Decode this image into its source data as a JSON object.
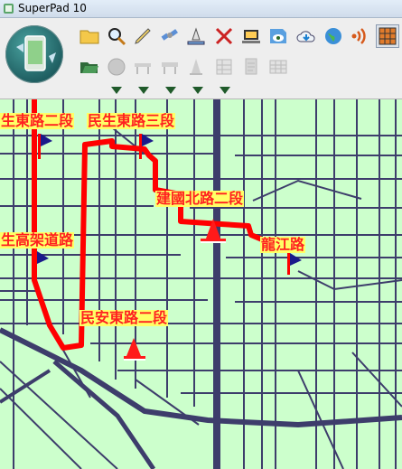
{
  "window": {
    "title": "SuperPad 10"
  },
  "toolbar": {
    "row1": [
      "open-folder-icon",
      "search-icon",
      "pen-icon",
      "satellite-icon",
      "ruler-icon",
      "close-tools-icon",
      "laptop-icon",
      "map-eye-icon",
      "cloud-download-icon",
      "globe-icon",
      "signal-icon",
      "grid-icon"
    ],
    "row2": [
      "folder-open-icon",
      "circle-icon",
      "barrier-icon",
      "barrier-alt-icon",
      "cone-icon",
      "table-icon",
      "document-icon",
      "spreadsheet-icon"
    ]
  },
  "map": {
    "route_color": "#ff0000",
    "road_color": "#3d3d6b",
    "background": "#ccffcc",
    "labels": {
      "l1": "生東路二段",
      "l2": "民生東路三段",
      "l3": "建國北路二段",
      "l4": "龍江路",
      "l5": "生高架道路",
      "l6": "民安東路二段"
    }
  }
}
